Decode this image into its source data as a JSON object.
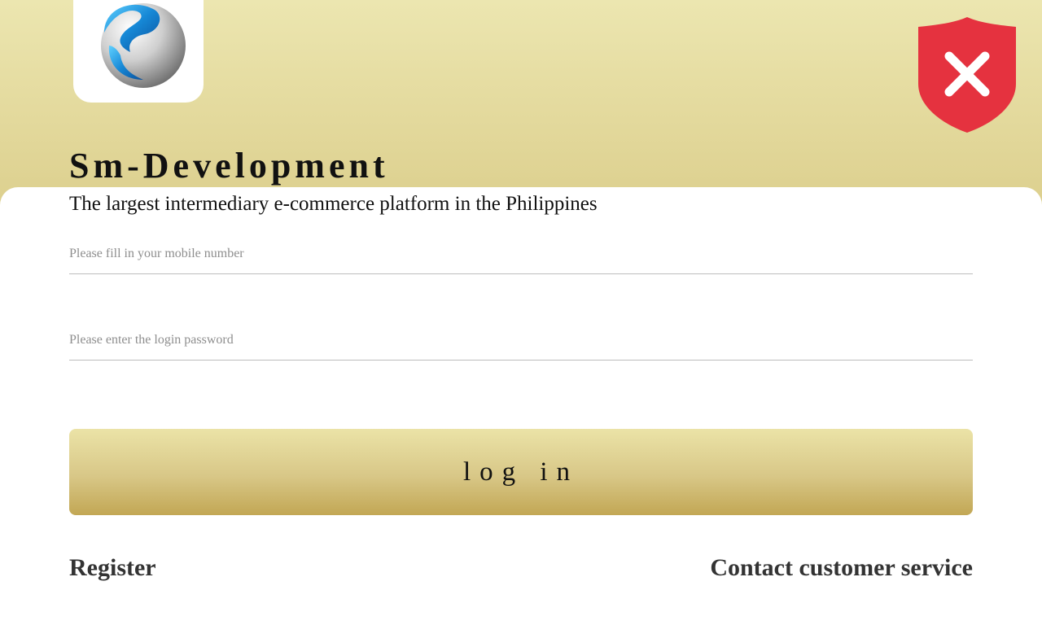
{
  "app": {
    "name": "Sm-Development",
    "tagline": "The largest intermediary e-commerce platform in the Philippines"
  },
  "form": {
    "mobile_placeholder": "Please fill in your mobile number",
    "mobile_value": "",
    "password_placeholder": "Please enter the login password",
    "password_value": "",
    "login_label": "log in"
  },
  "links": {
    "register": "Register",
    "contact": "Contact customer service"
  },
  "icons": {
    "logo": "sphere-logo-icon",
    "close": "shield-close-icon"
  },
  "colors": {
    "header_top": "#ece6b0",
    "header_bottom": "#dccf8d",
    "button_top": "#ebe3a7",
    "button_bottom": "#c2a754",
    "shield": "#e5323f",
    "text": "#111111"
  }
}
